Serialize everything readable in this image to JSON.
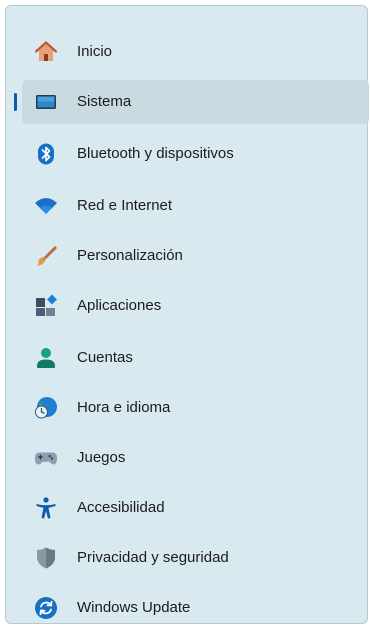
{
  "sidebar": {
    "selected_index": 1,
    "accent_color": "#0b5cad",
    "items": [
      {
        "label": "Inicio",
        "icon": "home-icon"
      },
      {
        "label": "Sistema",
        "icon": "display-icon"
      },
      {
        "label": "Bluetooth y dispositivos",
        "icon": "bluetooth-icon"
      },
      {
        "label": "Red e Internet",
        "icon": "wifi-icon"
      },
      {
        "label": "Personalización",
        "icon": "paintbrush-icon"
      },
      {
        "label": "Aplicaciones",
        "icon": "apps-icon"
      },
      {
        "label": "Cuentas",
        "icon": "account-icon"
      },
      {
        "label": "Hora e idioma",
        "icon": "clock-globe-icon"
      },
      {
        "label": "Juegos",
        "icon": "gamepad-icon"
      },
      {
        "label": "Accesibilidad",
        "icon": "accessibility-icon"
      },
      {
        "label": "Privacidad y seguridad",
        "icon": "shield-icon"
      },
      {
        "label": "Windows Update",
        "icon": "update-icon"
      }
    ]
  }
}
